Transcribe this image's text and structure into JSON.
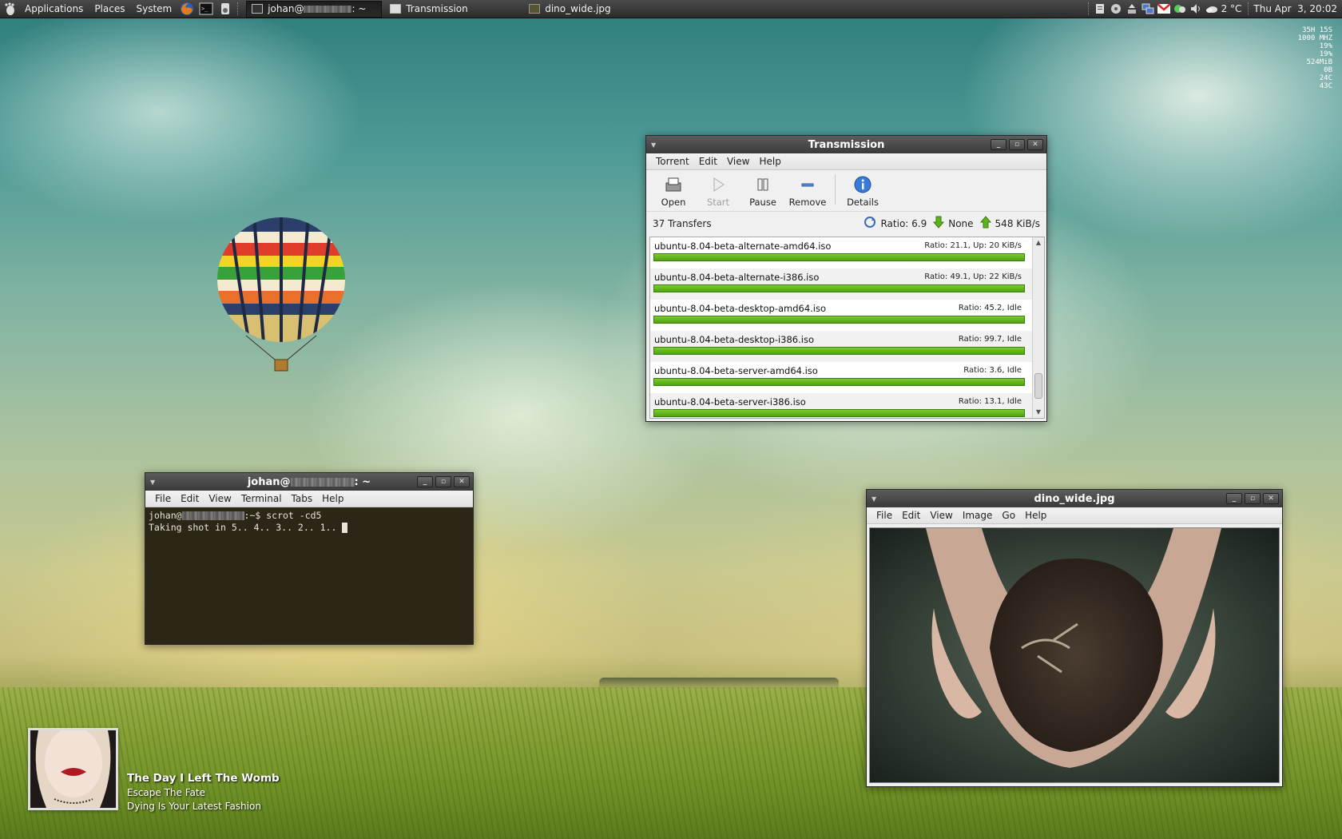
{
  "top_panel": {
    "menus": [
      "Applications",
      "Places",
      "System"
    ],
    "tasks": [
      {
        "label": "johan@",
        "suffix": ": ~",
        "active": true
      },
      {
        "label": "Transmission",
        "active": false
      },
      {
        "label": "dino_wide.jpg",
        "active": false
      }
    ],
    "weather": "2 °C",
    "clock": "Thu Apr  3, 20:02"
  },
  "conky": [
    "35H 15S",
    "1000 MHZ",
    "19%",
    "19%",
    "524MiB",
    "0B",
    "24C",
    "43C"
  ],
  "transmission": {
    "title": "Transmission",
    "menu": [
      "Torrent",
      "Edit",
      "View",
      "Help"
    ],
    "toolbar": {
      "open": "Open",
      "start": "Start",
      "pause": "Pause",
      "remove": "Remove",
      "details": "Details"
    },
    "status": {
      "transfers": "37 Transfers",
      "ratio": "Ratio: 6.9",
      "down": "None",
      "up": "548 KiB/s"
    },
    "torrents": [
      {
        "name": "ubuntu-8.04-beta-alternate-amd64.iso",
        "stats": "Ratio: 21.1, Up: 20 KiB/s",
        "progress": 100
      },
      {
        "name": "ubuntu-8.04-beta-alternate-i386.iso",
        "stats": "Ratio: 49.1, Up: 22 KiB/s",
        "progress": 100
      },
      {
        "name": "ubuntu-8.04-beta-desktop-amd64.iso",
        "stats": "Ratio: 45.2, Idle",
        "progress": 100
      },
      {
        "name": "ubuntu-8.04-beta-desktop-i386.iso",
        "stats": "Ratio: 99.7, Idle",
        "progress": 100
      },
      {
        "name": "ubuntu-8.04-beta-server-amd64.iso",
        "stats": "Ratio: 3.6, Idle",
        "progress": 100
      },
      {
        "name": "ubuntu-8.04-beta-server-i386.iso",
        "stats": "Ratio: 13.1, Idle",
        "progress": 100
      }
    ]
  },
  "terminal": {
    "title_prefix": "johan@",
    "title_suffix": ": ~",
    "menu": [
      "File",
      "Edit",
      "View",
      "Terminal",
      "Tabs",
      "Help"
    ],
    "line1_prefix": "johan@",
    "line1_cmd": ":~$ scrot -cd5",
    "line2": "Taking shot in 5.. 4.. 3.. 2.. 1.. "
  },
  "viewer": {
    "title": "dino_wide.jpg",
    "menu": [
      "File",
      "Edit",
      "View",
      "Image",
      "Go",
      "Help"
    ]
  },
  "now_playing": {
    "title": "The Day I Left The Womb",
    "artist": "Escape The Fate",
    "album": "Dying Is Your Latest Fashion"
  },
  "colors": {
    "progress_green": "#5cb31a",
    "panel_bg": "#333333",
    "titlebar": "#4a4a4a"
  }
}
